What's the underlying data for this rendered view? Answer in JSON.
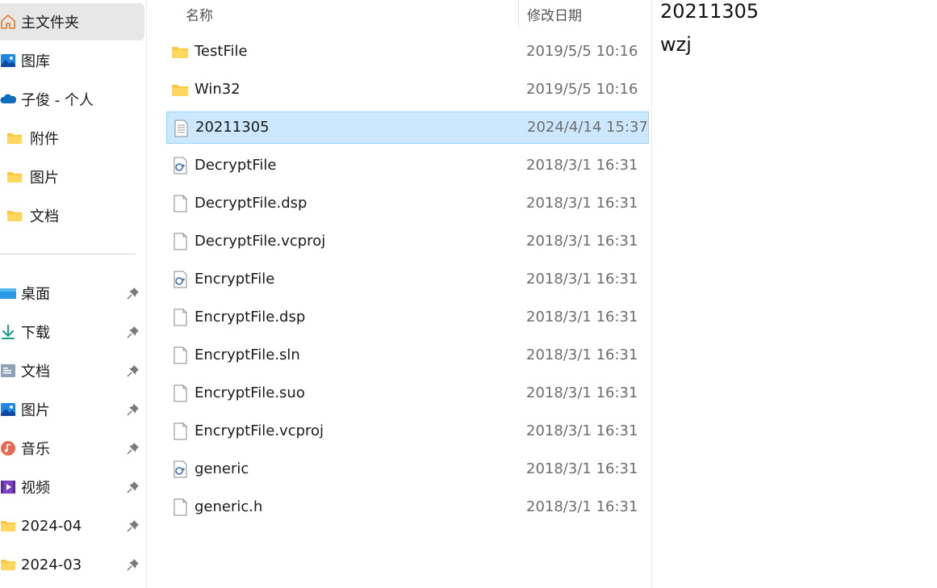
{
  "sidebar": {
    "items": [
      {
        "label": "主文件夹",
        "icon": "home-icon",
        "selected": true
      },
      {
        "label": "图库",
        "icon": "gallery-icon"
      },
      {
        "label": "子俊 - 个人",
        "icon": "onedrive-cloud-icon"
      },
      {
        "label": "附件",
        "icon": "folder-icon"
      },
      {
        "label": "图片",
        "icon": "folder-icon"
      },
      {
        "label": "文档",
        "icon": "folder-icon"
      }
    ],
    "pinned": [
      {
        "label": "桌面",
        "icon": "desktop-icon"
      },
      {
        "label": "下载",
        "icon": "download-icon"
      },
      {
        "label": "文档",
        "icon": "documents-icon"
      },
      {
        "label": "图片",
        "icon": "pictures-icon"
      },
      {
        "label": "音乐",
        "icon": "music-icon"
      },
      {
        "label": "视频",
        "icon": "videos-icon"
      },
      {
        "label": "2024-04",
        "icon": "folder-icon"
      },
      {
        "label": "2024-03",
        "icon": "folder-icon"
      }
    ]
  },
  "list": {
    "headers": {
      "name": "名称",
      "modified": "修改日期"
    },
    "rows": [
      {
        "name": "TestFile",
        "date": "2019/5/5 10:16",
        "type": "folder"
      },
      {
        "name": "Win32",
        "date": "2019/5/5 10:16",
        "type": "folder"
      },
      {
        "name": "20211305",
        "date": "2024/4/14 15:37",
        "type": "text",
        "selected": true
      },
      {
        "name": "DecryptFile",
        "date": "2018/3/1 16:31",
        "type": "cpp"
      },
      {
        "name": "DecryptFile.dsp",
        "date": "2018/3/1 16:31",
        "type": "file"
      },
      {
        "name": "DecryptFile.vcproj",
        "date": "2018/3/1 16:31",
        "type": "file"
      },
      {
        "name": "EncryptFile",
        "date": "2018/3/1 16:31",
        "type": "cpp"
      },
      {
        "name": "EncryptFile.dsp",
        "date": "2018/3/1 16:31",
        "type": "file"
      },
      {
        "name": "EncryptFile.sln",
        "date": "2018/3/1 16:31",
        "type": "file"
      },
      {
        "name": "EncryptFile.suo",
        "date": "2018/3/1 16:31",
        "type": "file"
      },
      {
        "name": "EncryptFile.vcproj",
        "date": "2018/3/1 16:31",
        "type": "file"
      },
      {
        "name": "generic",
        "date": "2018/3/1 16:31",
        "type": "cpp"
      },
      {
        "name": "generic.h",
        "date": "2018/3/1 16:31",
        "type": "file"
      }
    ]
  },
  "preview": {
    "lines": [
      "20211305",
      "wzj"
    ]
  },
  "colors": {
    "selection_bg": "#cce8ff",
    "selection_border": "#99d1ff",
    "nav_selected_bg": "#e7e7e7",
    "folder_yellow": "#ffc83d",
    "date_gray": "#6e6e6e"
  }
}
